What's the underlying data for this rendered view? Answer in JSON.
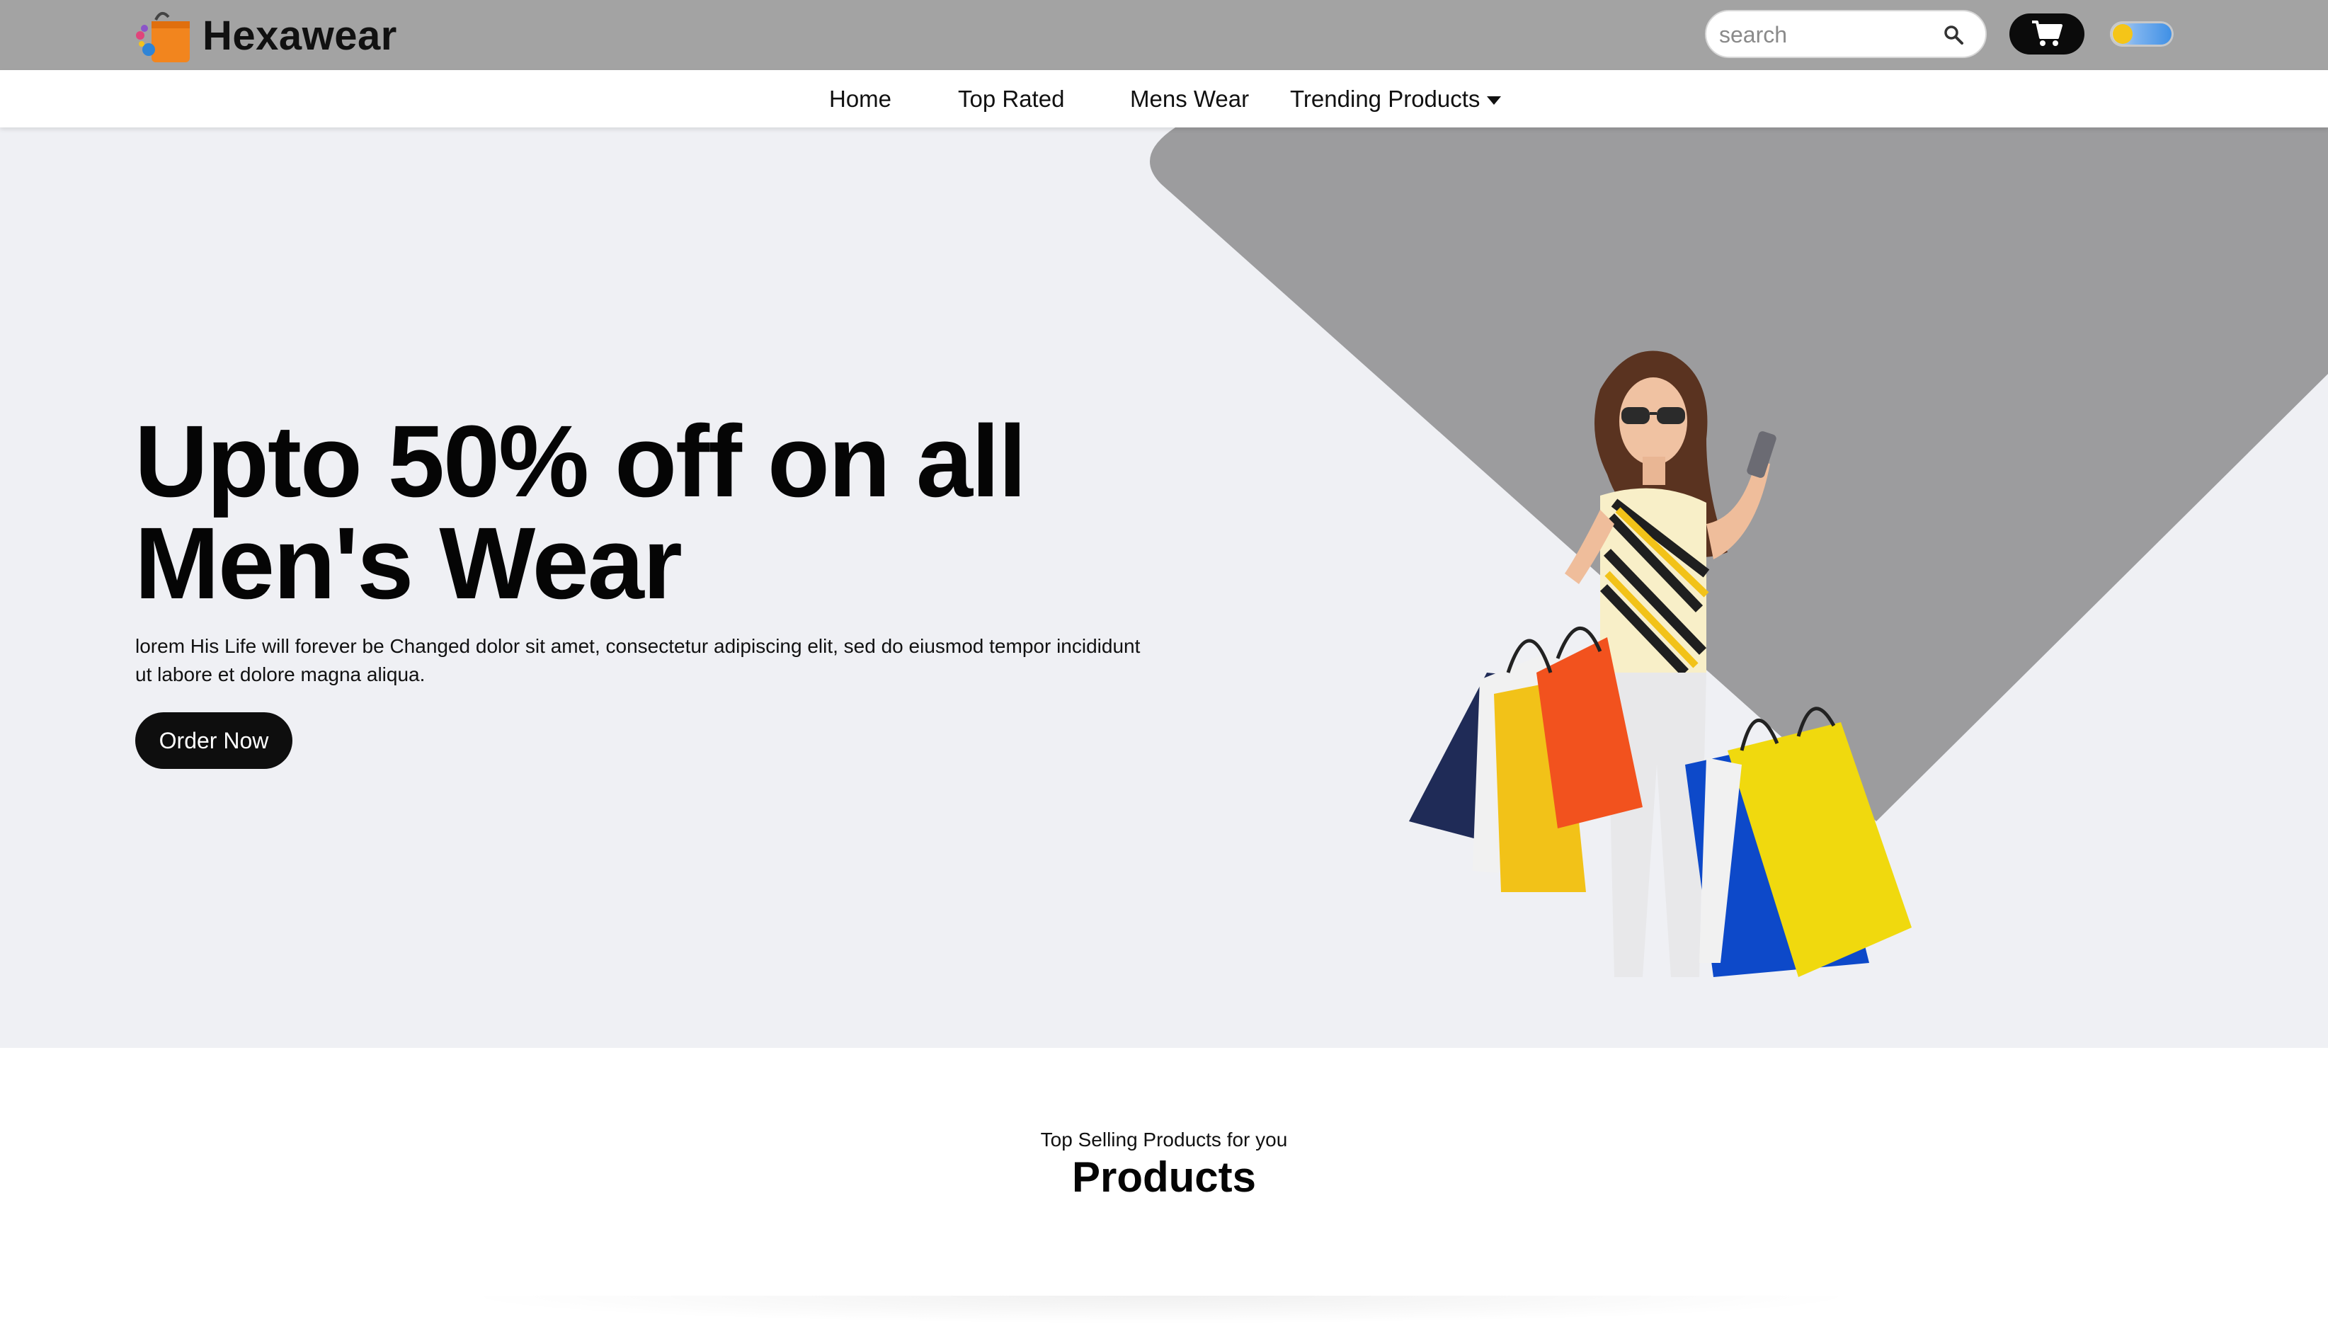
{
  "brand": {
    "name": "Hexawear",
    "logo_icon": "shopping-bag-icon"
  },
  "search": {
    "placeholder": "search",
    "icon": "search-icon"
  },
  "cart": {
    "icon": "cart-icon"
  },
  "theme_toggle": {
    "icon": "sun-cloud-toggle"
  },
  "nav": {
    "items": [
      {
        "label": "Home"
      },
      {
        "label": "Top Rated"
      },
      {
        "label": "Mens Wear"
      },
      {
        "label": "Trending Products",
        "has_dropdown": true
      }
    ]
  },
  "hero": {
    "title_line1": "Upto 50% off on all",
    "title_line2": "Men's Wear",
    "description": "lorem His Life will forever be Changed dolor sit amet, consectetur adipiscing elit, sed do eiusmod tempor incididunt ut labore et dolore magna aliqua.",
    "cta_label": "Order Now"
  },
  "products_section": {
    "subtitle": "Top Selling Products for you",
    "title": "Products"
  },
  "colors": {
    "topbar": "#a3a3a3",
    "hero_bg": "#eff0f4",
    "hero_shape": "#9c9c9e",
    "button": "#0e0e0e"
  }
}
